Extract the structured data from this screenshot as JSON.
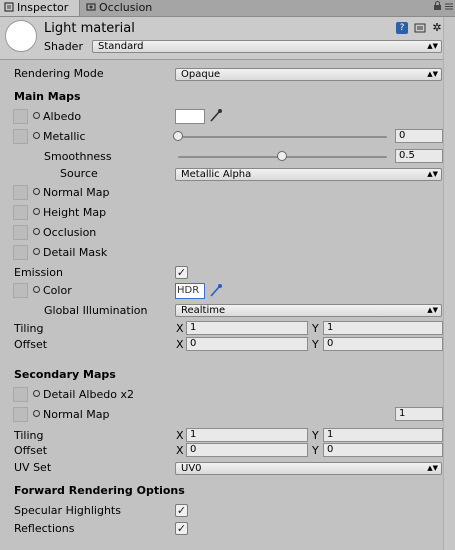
{
  "tabs": [
    {
      "label": "Inspector",
      "icon": "inspector-icon"
    },
    {
      "label": "Occlusion",
      "icon": "occlusion-icon"
    }
  ],
  "window_icons": [
    "lock-icon",
    "menu-icon"
  ],
  "header": {
    "material_name": "Light material",
    "shader_label": "Shader",
    "shader_value": "Standard",
    "buttons": [
      "help-icon",
      "preset-icon",
      "settings-icon"
    ]
  },
  "rendering_mode": {
    "label": "Rendering Mode",
    "value": "Opaque"
  },
  "main_maps": {
    "title": "Main Maps",
    "albedo": {
      "label": "Albedo",
      "color": "#ffffff"
    },
    "metallic": {
      "label": "Metallic",
      "value": "0",
      "level": 0
    },
    "smoothness": {
      "label": "Smoothness",
      "value": "0.5",
      "level": 0.5
    },
    "source": {
      "label": "Source",
      "value": "Metallic Alpha"
    },
    "normal_map": {
      "label": "Normal Map"
    },
    "height_map": {
      "label": "Height Map"
    },
    "occlusion": {
      "label": "Occlusion"
    },
    "detail_mask": {
      "label": "Detail Mask"
    },
    "emission": {
      "label": "Emission",
      "checked": true
    },
    "color": {
      "label": "Color",
      "value": "HDR"
    },
    "global_illumination": {
      "label": "Global Illumination",
      "value": "Realtime"
    },
    "tiling": {
      "label": "Tiling",
      "x_label": "X",
      "x": "1",
      "y_label": "Y",
      "y": "1"
    },
    "offset": {
      "label": "Offset",
      "x_label": "X",
      "x": "0",
      "y_label": "Y",
      "y": "0"
    }
  },
  "secondary_maps": {
    "title": "Secondary Maps",
    "detail_albedo": {
      "label": "Detail Albedo x2"
    },
    "normal_map": {
      "label": "Normal Map",
      "value": "1"
    },
    "tiling": {
      "label": "Tiling",
      "x_label": "X",
      "x": "1",
      "y_label": "Y",
      "y": "1"
    },
    "offset": {
      "label": "Offset",
      "x_label": "X",
      "x": "0",
      "y_label": "Y",
      "y": "0"
    },
    "uv_set": {
      "label": "UV Set",
      "value": "UV0"
    }
  },
  "forward_rendering": {
    "title": "Forward Rendering Options",
    "specular_highlights": {
      "label": "Specular Highlights",
      "checked": true
    },
    "reflections": {
      "label": "Reflections",
      "checked": true
    }
  }
}
